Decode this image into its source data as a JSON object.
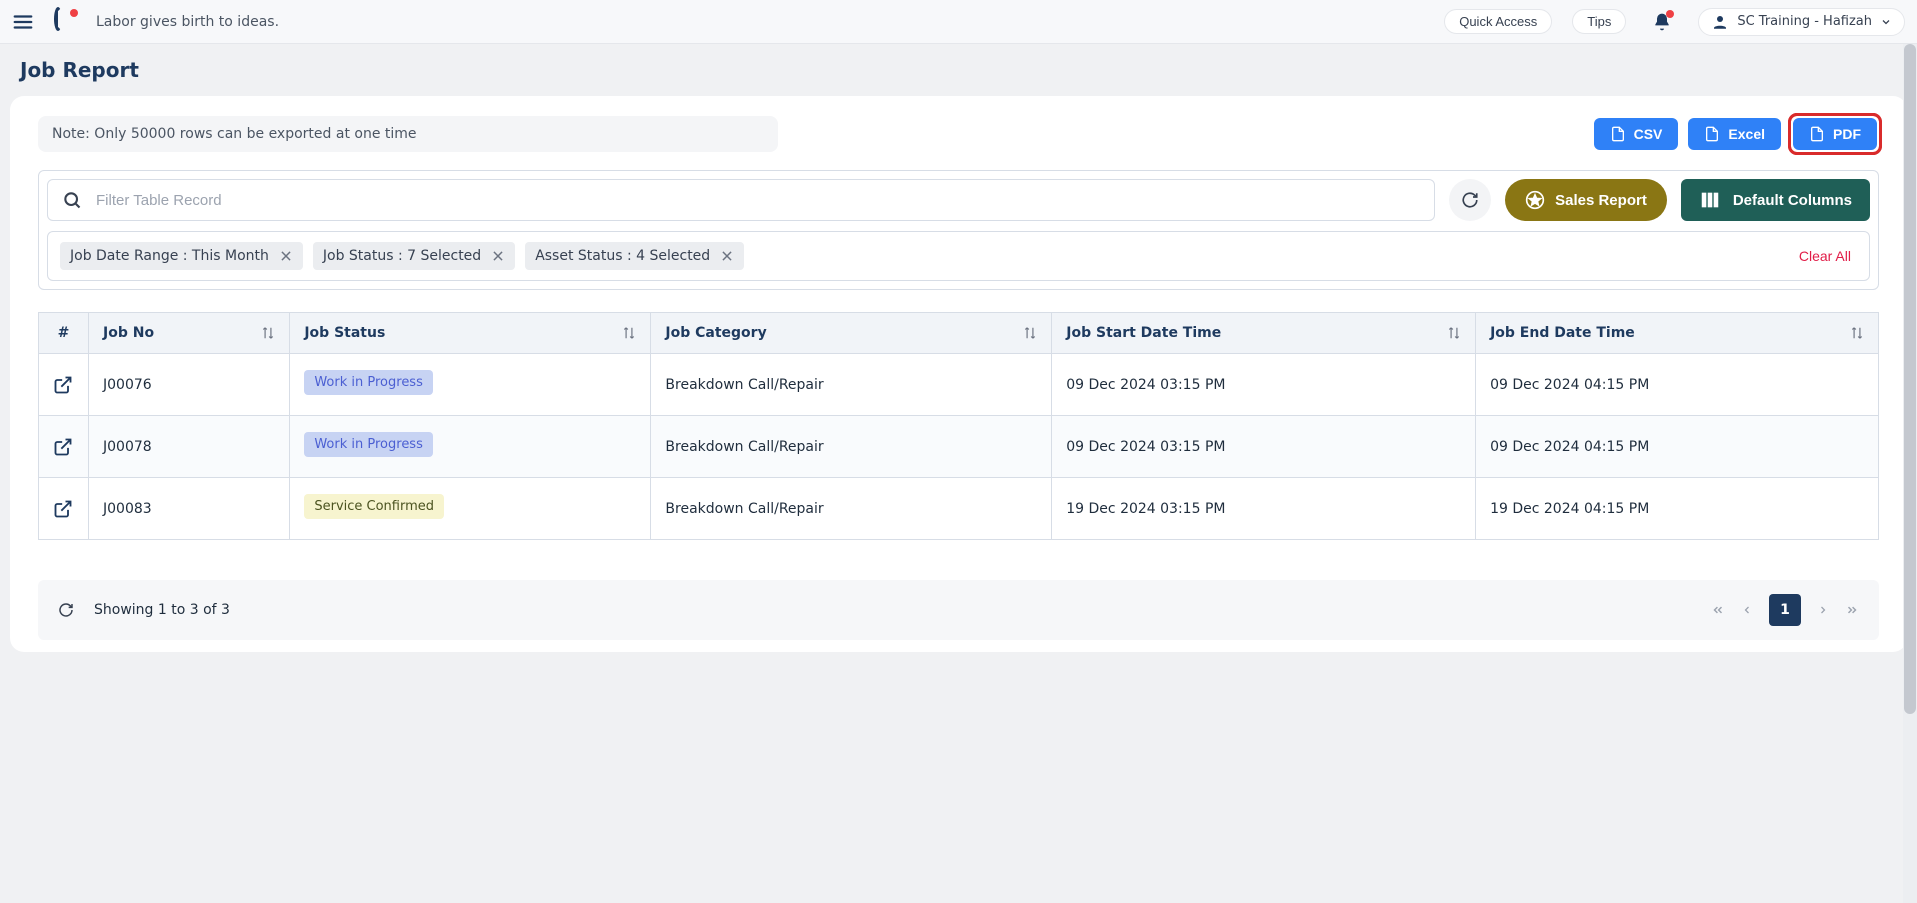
{
  "header": {
    "motto": "Labor gives birth to ideas.",
    "quick_access": "Quick Access",
    "tips": "Tips",
    "user_label": "SC Training - Hafizah"
  },
  "page_title": "Job Report",
  "toolbar": {
    "note": "Note: Only 50000 rows can be exported at one time",
    "csv": "CSV",
    "excel": "Excel",
    "pdf": "PDF"
  },
  "search": {
    "placeholder": "Filter Table Record",
    "sales_report": "Sales Report",
    "default_columns": "Default Columns"
  },
  "filters": {
    "chip1_label": "Job Date Range  :  This Month",
    "chip2_label": "Job Status  :  7 Selected",
    "chip3_label": "Asset Status  :  4 Selected",
    "clear_all": "Clear All"
  },
  "columns": {
    "hash": "#",
    "job_no": "Job No",
    "job_status": "Job Status",
    "job_category": "Job Category",
    "start": "Job Start Date Time",
    "end": "Job End Date Time"
  },
  "rows": [
    {
      "job_no": "J00076",
      "status_text": "Work in Progress",
      "status_class": "status-wip",
      "category": "Breakdown Call/Repair",
      "start": "09 Dec 2024 03:15 PM",
      "end": "09 Dec 2024 04:15 PM"
    },
    {
      "job_no": "J00078",
      "status_text": "Work in Progress",
      "status_class": "status-wip",
      "category": "Breakdown Call/Repair",
      "start": "09 Dec 2024 03:15 PM",
      "end": "09 Dec 2024 04:15 PM"
    },
    {
      "job_no": "J00083",
      "status_text": "Service Confirmed",
      "status_class": "status-conf",
      "category": "Breakdown Call/Repair",
      "start": "19 Dec 2024 03:15 PM",
      "end": "19 Dec 2024 04:15 PM"
    }
  ],
  "pagination": {
    "showing": "Showing 1 to 3 of 3",
    "current": "1"
  }
}
